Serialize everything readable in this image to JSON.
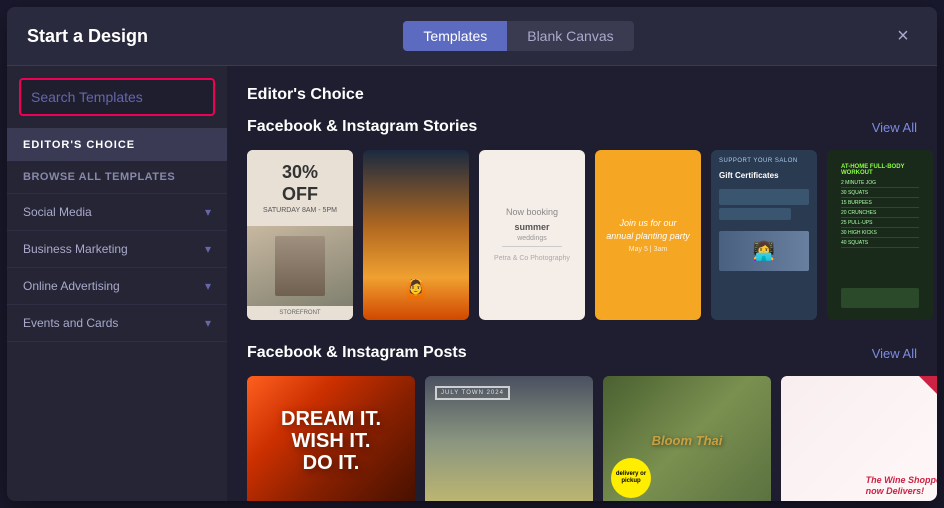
{
  "modal": {
    "title": "Start a Design",
    "close_label": "×"
  },
  "tabs": {
    "templates_label": "Templates",
    "blank_canvas_label": "Blank Canvas"
  },
  "search": {
    "placeholder": "Search Templates"
  },
  "sidebar": {
    "editors_choice_label": "EDITOR'S CHOICE",
    "browse_all_label": "BROWSE ALL TEMPLATES",
    "sections": [
      {
        "label": "Social Media"
      },
      {
        "label": "Business Marketing"
      },
      {
        "label": "Online Advertising"
      },
      {
        "label": "Events and Cards"
      }
    ]
  },
  "main": {
    "heading": "Editor's Choice",
    "stories_section": {
      "title": "Facebook & Instagram Stories",
      "view_all": "View All"
    },
    "posts_section": {
      "title": "Facebook & Instagram Posts",
      "view_all": "View All"
    }
  },
  "stories_cards": [
    {
      "id": "card-story-1",
      "type": "sale"
    },
    {
      "id": "card-story-2",
      "type": "landscape"
    },
    {
      "id": "card-story-3",
      "type": "booking"
    },
    {
      "id": "card-story-4",
      "type": "planting"
    },
    {
      "id": "card-story-5",
      "type": "gift"
    },
    {
      "id": "card-story-6",
      "type": "workout"
    }
  ],
  "posts_cards": [
    {
      "id": "card-post-1",
      "type": "dream"
    },
    {
      "id": "card-post-2",
      "type": "travel"
    },
    {
      "id": "card-post-3",
      "type": "food"
    },
    {
      "id": "card-post-4",
      "type": "wine"
    }
  ]
}
